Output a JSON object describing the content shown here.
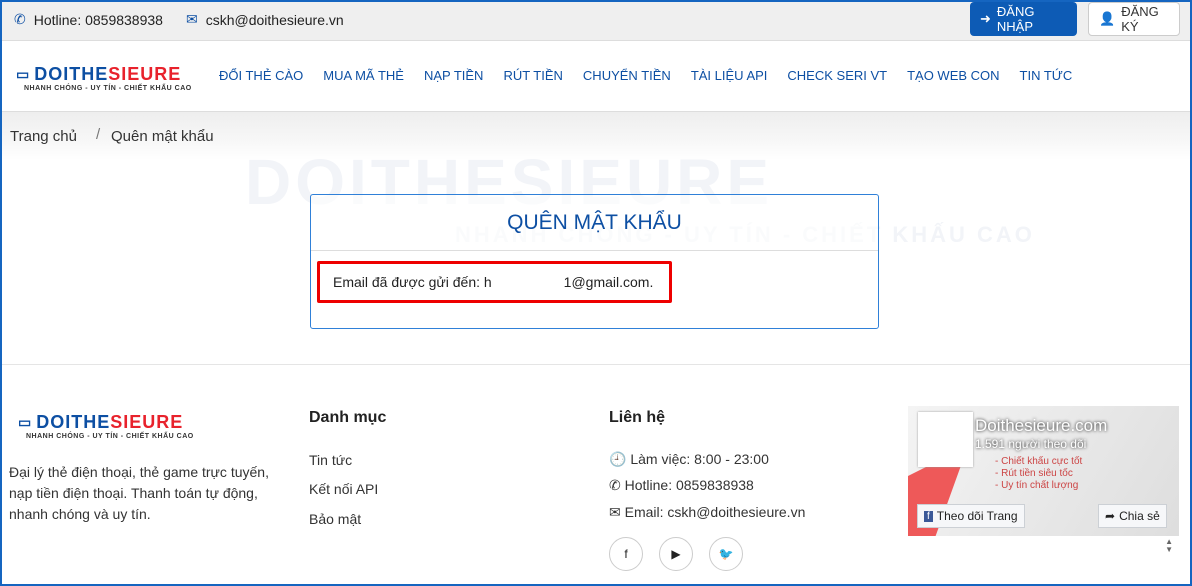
{
  "topbar": {
    "hotline": "Hotline: 0859838938",
    "email": "cskh@doithesieure.vn",
    "login": "ĐĂNG NHẬP",
    "register": "ĐĂNG KÝ"
  },
  "logo": {
    "part1": "DOITHE",
    "part2": "SIEURE",
    "tagline": "NHANH CHÓNG - UY TÍN - CHIẾT KHẤU CAO"
  },
  "menu": [
    "ĐỔI THẺ CÀO",
    "MUA MÃ THẺ",
    "NẠP TIỀN",
    "RÚT TIỀN",
    "CHUYỂN TIỀN",
    "TÀI LIỆU API",
    "CHECK SERI VT",
    "TẠO WEB CON",
    "TIN TỨC"
  ],
  "breadcrumb": {
    "home": "Trang chủ",
    "sep": "/",
    "current": "Quên mật khẩu"
  },
  "card": {
    "title": "QUÊN MẬT KHẨU",
    "message_prefix": "Email đã được gửi đến: h",
    "message_suffix": "1@gmail.com."
  },
  "footer": {
    "about": "Đại lý thẻ điện thoại, thẻ game trực tuyến, nạp tiền điện thoại. Thanh toán tự động, nhanh chóng và uy tín.",
    "categories_title": "Danh mục",
    "categories": [
      "Tin tức",
      "Kết nối API",
      "Bảo mật"
    ],
    "contact_title": "Liên hệ",
    "hours": "Làm việc: 8:00 - 23:00",
    "hotline": "Hotline: 0859838938",
    "email": "Email: cskh@doithesieure.vn",
    "social": [
      "facebook-icon",
      "youtube-icon",
      "twitter-icon"
    ]
  },
  "fb_widget": {
    "page_name": "Doithesieure.com",
    "followers": "1.591 người theo dõi",
    "follow": "Theo dõi Trang",
    "share": "Chia sẻ",
    "banner_lines": [
      "- Chiết khấu cực tốt",
      "- Rút tiền siêu tốc",
      "- Uy tín chất lượng"
    ]
  },
  "colors": {
    "brand_blue": "#0d4fa3",
    "brand_red": "#e8222c",
    "highlight": "#ee0000"
  }
}
